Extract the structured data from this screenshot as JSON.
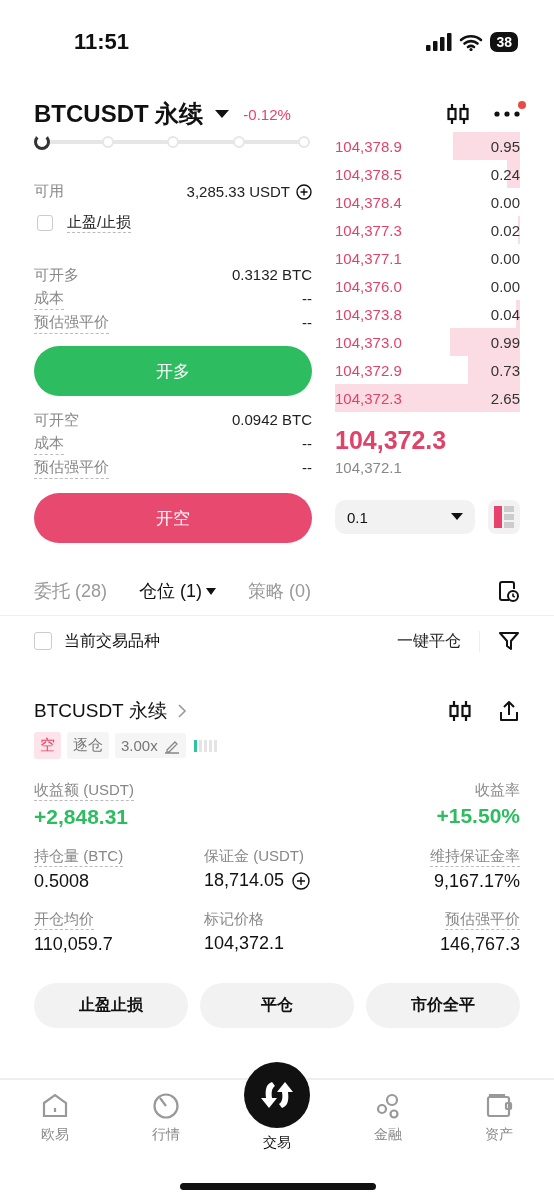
{
  "status_bar": {
    "time": "11:51",
    "battery": "38"
  },
  "header": {
    "symbol": "BTCUSDT 永续",
    "change": "-0.12%"
  },
  "order_form": {
    "leverage_slider": {
      "level": 0
    },
    "available": {
      "label": "可用",
      "value": "3,285.33 USDT"
    },
    "tpsl": {
      "label": "止盈/止损",
      "checked": false
    },
    "long": {
      "rows": [
        {
          "label": "可开多",
          "value": "0.3132 BTC",
          "tooltip": false
        },
        {
          "label": "成本",
          "value": "--",
          "tooltip": true
        },
        {
          "label": "预估强平价",
          "value": "--",
          "tooltip": true
        }
      ],
      "button": "开多"
    },
    "short": {
      "rows": [
        {
          "label": "可开空",
          "value": "0.0942 BTC",
          "tooltip": false
        },
        {
          "label": "成本",
          "value": "--",
          "tooltip": true
        },
        {
          "label": "预估强平价",
          "value": "--",
          "tooltip": true
        }
      ],
      "button": "开空"
    }
  },
  "order_book": {
    "asks": [
      {
        "price": "104,378.9",
        "amount": "0.95"
      },
      {
        "price": "104,378.5",
        "amount": "0.24"
      },
      {
        "price": "104,378.4",
        "amount": "0.00"
      },
      {
        "price": "104,377.3",
        "amount": "0.02"
      },
      {
        "price": "104,377.1",
        "amount": "0.00"
      },
      {
        "price": "104,376.0",
        "amount": "0.00"
      },
      {
        "price": "104,373.8",
        "amount": "0.04"
      },
      {
        "price": "104,373.0",
        "amount": "0.99"
      },
      {
        "price": "104,372.9",
        "amount": "0.73"
      },
      {
        "price": "104,372.3",
        "amount": "2.65"
      }
    ],
    "last_price": "104,372.3",
    "mark_price": "104,372.1",
    "precision": "0.1"
  },
  "position_tabs": [
    {
      "label": "委托 (28)",
      "selected": false,
      "dropdown": false
    },
    {
      "label": "仓位 (1)",
      "selected": true,
      "dropdown": true
    },
    {
      "label": "策略 (0)",
      "selected": false,
      "dropdown": false
    }
  ],
  "filter": {
    "current_symbol": {
      "label": "当前交易品种",
      "checked": false
    },
    "close_all": "一键平仓"
  },
  "position": {
    "symbol": "BTCUSDT 永续",
    "tags": [
      {
        "kind": "side",
        "text": "空"
      },
      {
        "kind": "margin",
        "text": "逐仓"
      },
      {
        "kind": "leverage",
        "text": "3.00x"
      }
    ],
    "risk": {
      "level": 0.2
    },
    "pnl": {
      "label": "收益额 (USDT)",
      "value": "+2,848.31",
      "tooltip": true
    },
    "roe": {
      "label": "收益率",
      "value": "+15.50%",
      "tooltip": false
    },
    "fields": [
      {
        "label": "持仓量 (BTC)",
        "value": "0.5008",
        "tooltip": true,
        "add_button": false
      },
      {
        "label": "保证金 (USDT)",
        "value": "18,714.05",
        "tooltip": false,
        "add_button": true
      },
      {
        "label": "维持保证金率",
        "value": "9,167.17%",
        "tooltip": true,
        "add_button": false
      },
      {
        "label": "开仓均价",
        "value": "110,059.7",
        "tooltip": true,
        "add_button": false
      },
      {
        "label": "标记价格",
        "value": "104,372.1",
        "tooltip": false,
        "add_button": false
      },
      {
        "label": "预估强平价",
        "value": "146,767.3",
        "tooltip": true,
        "add_button": false
      }
    ],
    "actions": [
      "止盈止损",
      "平仓",
      "市价全平"
    ]
  },
  "bottom_nav": [
    {
      "label": "欧易",
      "selected": false
    },
    {
      "label": "行情",
      "selected": false
    },
    {
      "label": "交易",
      "selected": true
    },
    {
      "label": "金融",
      "selected": false
    },
    {
      "label": "资产",
      "selected": false
    }
  ]
}
